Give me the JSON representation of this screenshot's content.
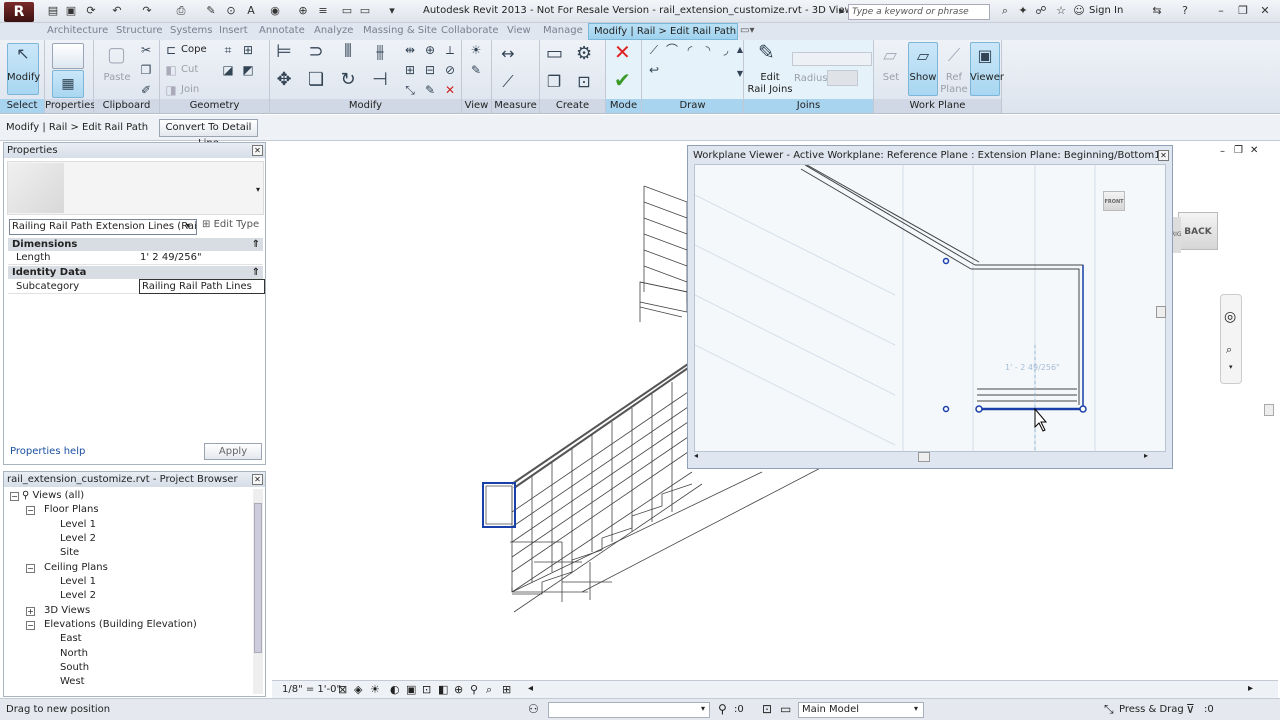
{
  "titlebar": {
    "logo": "R",
    "title": "Autodesk Revit 2013 -  Not For Resale Version -     rail_extension_customize.rvt - 3D View: {3D}",
    "search_placeholder": "Type a keyword or phrase",
    "signin": "Sign In"
  },
  "tabs": [
    "Architecture",
    "Structure",
    "Systems",
    "Insert",
    "Annotate",
    "Analyze",
    "Massing & Site",
    "Collaborate",
    "View",
    "Manage"
  ],
  "active_tab": "Modify | Rail > Edit Rail Path",
  "ribbon": {
    "select": {
      "modify": "Modify",
      "label": "Select"
    },
    "properties": {
      "label": "Properties"
    },
    "clipboard": {
      "paste": "Paste",
      "label": "Clipboard"
    },
    "geometry": {
      "cope": "Cope",
      "cut": "Cut",
      "join": "Join",
      "label": "Geometry"
    },
    "modify_panel": {
      "label": "Modify"
    },
    "view": {
      "label": "View"
    },
    "measure": {
      "label": "Measure"
    },
    "create": {
      "label": "Create"
    },
    "mode": {
      "label": "Mode"
    },
    "draw": {
      "label": "Draw"
    },
    "joins": {
      "edit_rail_joins_1": "Edit",
      "edit_rail_joins_2": "Rail Joins",
      "radius": "Radius:",
      "label": "Joins"
    },
    "workplane": {
      "set": "Set",
      "show": "Show",
      "ref_plane_1": "Ref",
      "ref_plane_2": "Plane",
      "viewer": "Viewer",
      "label": "Work Plane"
    }
  },
  "optionsbar": {
    "context": "Modify | Rail > Edit Rail Path",
    "convert": "Convert To Detail Line"
  },
  "properties": {
    "title": "Properties",
    "type": "Railing Rail Path Extension Lines (Railing",
    "edit_type": "Edit Type",
    "cat_dimensions": "Dimensions",
    "length_name": "Length",
    "length_val": "1'  2 49/256\"",
    "cat_identity": "Identity Data",
    "subcategory_name": "Subcategory",
    "subcategory_val": "Railing Rail Path Lines",
    "help": "Properties help",
    "apply": "Apply"
  },
  "browser": {
    "title": "rail_extension_customize.rvt - Project Browser",
    "items": [
      "Views (all)",
      "Floor Plans",
      "Level 1",
      "Level 2",
      "Site",
      "Ceiling Plans",
      "Level 1",
      "Level 2",
      "3D Views",
      "Elevations (Building Elevation)",
      "East",
      "North",
      "South",
      "West"
    ]
  },
  "viewer": {
    "title": "Workplane Viewer - Active Workplane: Reference Plane : Extension Plane: Beginning/Bottom1",
    "dim_text": "1' - 2 49/256\"",
    "front_label": "FRONT"
  },
  "viewcube": {
    "back": "BACK",
    "right": "RIGHT"
  },
  "viewctrl": {
    "scale": "1/8\" = 1'-0\""
  },
  "statusbar": {
    "status": "Drag to new position",
    "count": ":0",
    "workset": "Main Model",
    "press_drag": "Press & Drag"
  },
  "colors": {
    "accent": "#9fd2ee",
    "drawing_line": "#333333",
    "selected_line": "#1a3fa8"
  }
}
